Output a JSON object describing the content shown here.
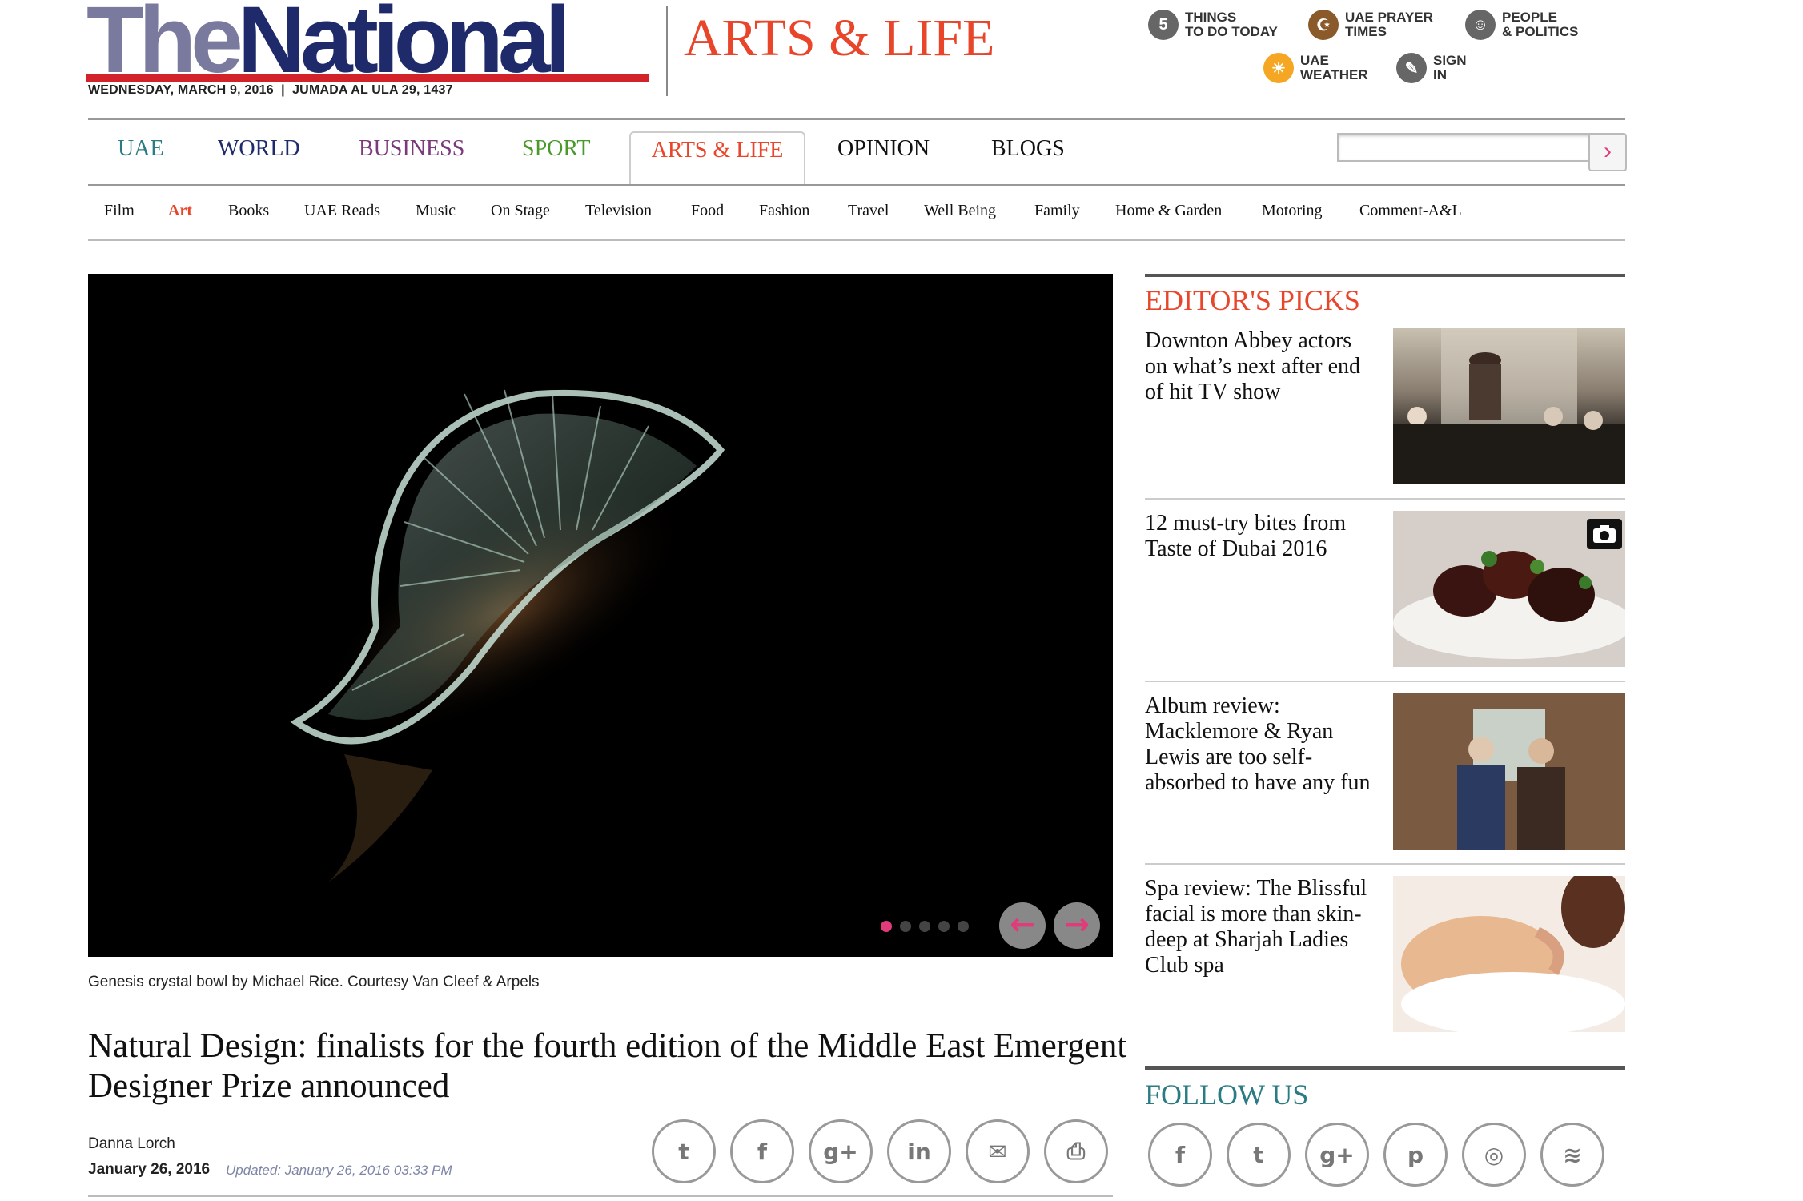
{
  "header": {
    "logo_the": "The",
    "logo_national": "National",
    "date": "WEDNESDAY, MARCH 9, 2016  |  JUMADA AL ULA 29, 1437",
    "section_title": "ARTS & LIFE",
    "utility_links": [
      {
        "label": "THINGS\nTO DO TODAY",
        "icon": "things-to-do-icon",
        "glyph": "5"
      },
      {
        "label": "UAE PRAYER\nTIMES",
        "icon": "prayer-times-icon",
        "glyph": "☪"
      },
      {
        "label": "PEOPLE\n& POLITICS",
        "icon": "people-politics-icon",
        "glyph": "☺"
      },
      {
        "label": "UAE\nWEATHER",
        "icon": "weather-sun-icon",
        "glyph": "☀"
      },
      {
        "label": "SIGN\nIN",
        "icon": "sign-in-icon",
        "glyph": "✎"
      }
    ]
  },
  "nav": {
    "items": [
      {
        "label": "UAE",
        "color": "#2a7b83"
      },
      {
        "label": "WORLD",
        "color": "#1f2a6b"
      },
      {
        "label": "BUSINESS",
        "color": "#7b3a7c"
      },
      {
        "label": "SPORT",
        "color": "#4a9a2a"
      },
      {
        "label": "ARTS & LIFE",
        "color": "#e8452a"
      },
      {
        "label": "OPINION",
        "color": "#111111"
      },
      {
        "label": "BLOGS",
        "color": "#111111"
      }
    ],
    "search_placeholder": "",
    "search_button": "›"
  },
  "subnav": {
    "items": [
      "Film",
      "Art",
      "Books",
      "UAE Reads",
      "Music",
      "On Stage",
      "Television",
      "Food",
      "Fashion",
      "Travel",
      "Well Being",
      "Family",
      "Home & Garden",
      "Motoring",
      "Comment-A&L"
    ],
    "active": "Art",
    "active_color": "#e8452a"
  },
  "article": {
    "caption": "Genesis crystal bowl by Michael Rice. Courtesy Van Cleef & Arpels",
    "headline": "Natural Design: finalists for the fourth edition of the Middle East Emergent Designer Prize announced",
    "author": "Danna Lorch",
    "date": "January 26, 2016",
    "updated": "Updated: January 26, 2016 03:33 PM",
    "slideshow": {
      "slides": 5,
      "current": 1,
      "prev": "←",
      "next": "→"
    },
    "share": [
      {
        "name": "twitter-share-button",
        "glyph": "t"
      },
      {
        "name": "facebook-share-button",
        "glyph": "f"
      },
      {
        "name": "google-plus-share-button",
        "glyph": "g+"
      },
      {
        "name": "linkedin-share-button",
        "glyph": "in"
      },
      {
        "name": "email-share-button",
        "glyph": "✉"
      },
      {
        "name": "print-button",
        "glyph": "⎙"
      }
    ]
  },
  "sidebar": {
    "editors_picks_title": "EDITOR'S PICKS",
    "picks": [
      {
        "title": "Downton Abbey actors on what’s next after end of hit TV show"
      },
      {
        "title": "12 must-try bites from Taste of Dubai 2016"
      },
      {
        "title": "Album review: Macklemore & Ryan Lewis are too self-absorbed to have any fun"
      },
      {
        "title": "Spa review: The Blissful facial is more than skin-deep at Sharjah Ladies Club spa"
      }
    ],
    "follow_title": "FOLLOW US",
    "follow": [
      {
        "name": "facebook-follow-button",
        "glyph": "f"
      },
      {
        "name": "twitter-follow-button",
        "glyph": "t"
      },
      {
        "name": "google-plus-follow-button",
        "glyph": "g+"
      },
      {
        "name": "pinterest-follow-button",
        "glyph": "p"
      },
      {
        "name": "instagram-follow-button",
        "glyph": "◎"
      },
      {
        "name": "rss-follow-button",
        "glyph": "≋"
      }
    ]
  }
}
